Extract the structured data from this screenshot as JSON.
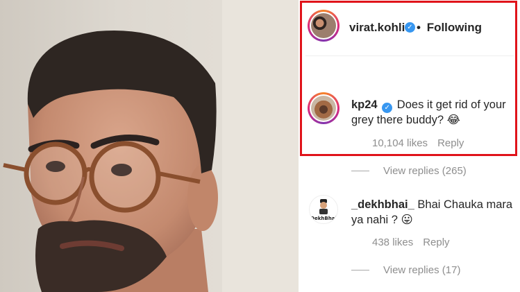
{
  "post": {
    "author": "virat.kohli",
    "separator": "•",
    "follow_status": "Following"
  },
  "comments": [
    {
      "username": "kp24",
      "verified": true,
      "text": "Does it get rid of your grey there buddy? 😂",
      "likes": "10,104 likes",
      "reply_label": "Reply",
      "view_replies": "View replies (265)"
    },
    {
      "username": "_dekhbhai_",
      "verified": false,
      "text": "Bhai Chauka mara ya nahi ? 😛",
      "likes": "438 likes",
      "reply_label": "Reply",
      "view_replies": "View replies (17)",
      "avatar_text": "DekhBhai"
    }
  ],
  "colors": {
    "highlight_border": "#e0131a",
    "verified_badge": "#3897f0",
    "meta_text": "#8e8e8e"
  },
  "icons": {
    "verified": "verified-badge-icon"
  }
}
